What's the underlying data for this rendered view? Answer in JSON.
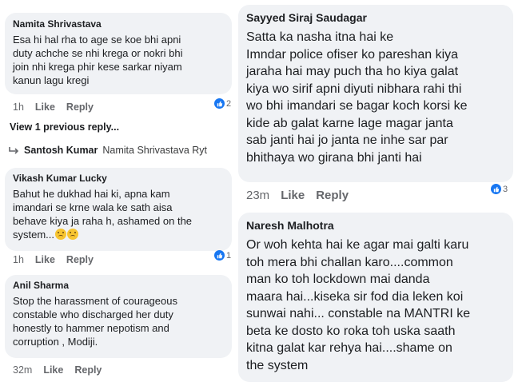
{
  "left_comments": [
    {
      "author": "Namita Shrivastava",
      "text": "Esa hi hal rha to age se koe bhi apni\nduty achche se nhi krega or nokri bhi\njoin nhi krega phir kese sarkar niyam\nkanun lagu kregi",
      "time": "1h",
      "like": "Like",
      "reply": "Reply",
      "reactions": "2"
    },
    {
      "author": "Vikash Kumar Lucky",
      "text": "Bahut he dukhad hai ki, apna kam\nimandari se krne wala ke sath aisa\nbehave kiya ja raha h, ashamed on the\nsystem...",
      "time": "1h",
      "like": "Like",
      "reply": "Reply",
      "reactions": "1"
    },
    {
      "author": "Anil Sharma",
      "text": "Stop the harassment of courageous\nconstable who discharged her duty\nhonestly to hammer nepotism and\ncorruption , Modiji.",
      "time": "32m",
      "like": "Like",
      "reply": "Reply"
    }
  ],
  "previous_replies": "View 1 previous reply...",
  "reply_preview": {
    "author": "Santosh Kumar",
    "text": "Namita Shrivastava Ryt"
  },
  "right_comments": [
    {
      "author": "Sayyed Siraj Saudagar",
      "text": "Satta ka nasha itna hai ke\nImndar police ofiser ko pareshan kiya\njaraha hai may puch tha ho kiya galat\nkiya wo sirif apni diyuti nibhara rahi thi\nwo bhi imandari se bagar koch korsi ke\nkide ab galat karne lage magar janta\nsab janti hai jo janta ne inhe sar par\nbhithaya wo girana bhi janti hai",
      "time": "23m",
      "like": "Like",
      "reply": "Reply",
      "reactions": "3"
    },
    {
      "author": "Naresh Malhotra",
      "text": "Or woh kehta hai ke agar mai galti karu\ntoh mera bhi challan karo....common\nman ko toh lockdown mai danda\nmaara hai...kiseka sir fod dia leken koi\nsunwai nahi... constable na MANTRI ke\nbeta ke dosto ko roka toh uska saath\nkitna galat kar rehya hai....shame on\nthe system"
    }
  ],
  "colors": {
    "bubble": "#f0f2f5",
    "reaction": "#1877f2",
    "meta": "#65676b"
  }
}
